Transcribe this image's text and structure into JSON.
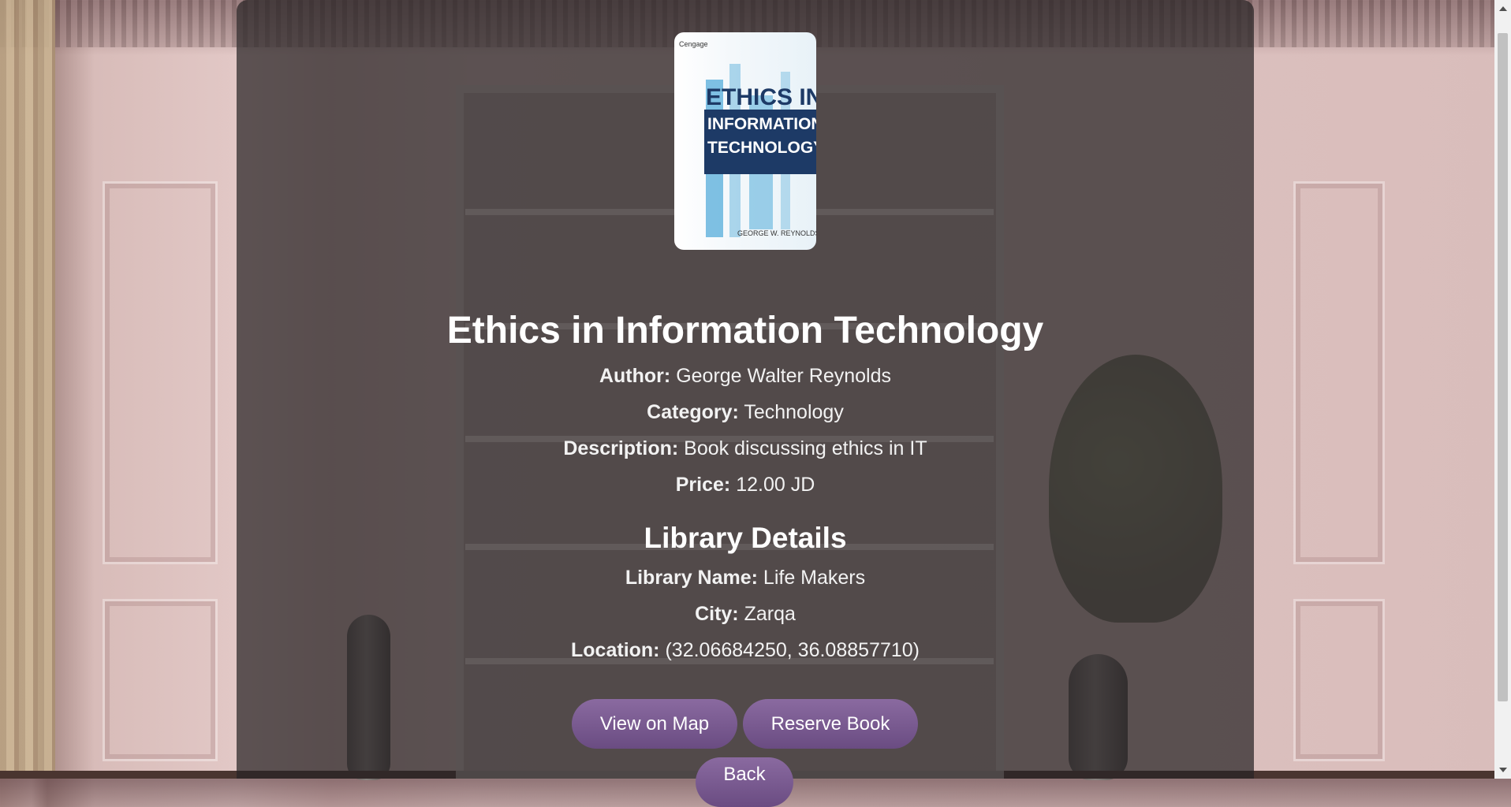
{
  "book": {
    "cover_alt": "Ethics in Information Technology cover",
    "cover_text": {
      "publisher": "Cengage",
      "line1": "ETHICS IN",
      "line2": "INFORMATION",
      "line3": "TECHNOLOGY",
      "author": "GEORGE W. REYNOLDS"
    },
    "title": "Ethics in Information Technology",
    "author_label": "Author:",
    "author": "George Walter Reynolds",
    "category_label": "Category:",
    "category": "Technology",
    "description_label": "Description:",
    "description": "Book discussing ethics in IT",
    "price_label": "Price:",
    "price": "12.00 JD"
  },
  "library": {
    "heading": "Library Details",
    "name_label": "Library Name:",
    "name": "Life Makers",
    "city_label": "City:",
    "city": "Zarqa",
    "location_label": "Location:",
    "location": "(32.06684250, 36.08857710)"
  },
  "actions": {
    "view_map": "View on Map",
    "reserve": "Reserve Book",
    "back": "Back"
  },
  "colors": {
    "button": "#7a5b92",
    "overlay": "rgba(40,36,38,0.72)",
    "text": "#ffffff"
  }
}
